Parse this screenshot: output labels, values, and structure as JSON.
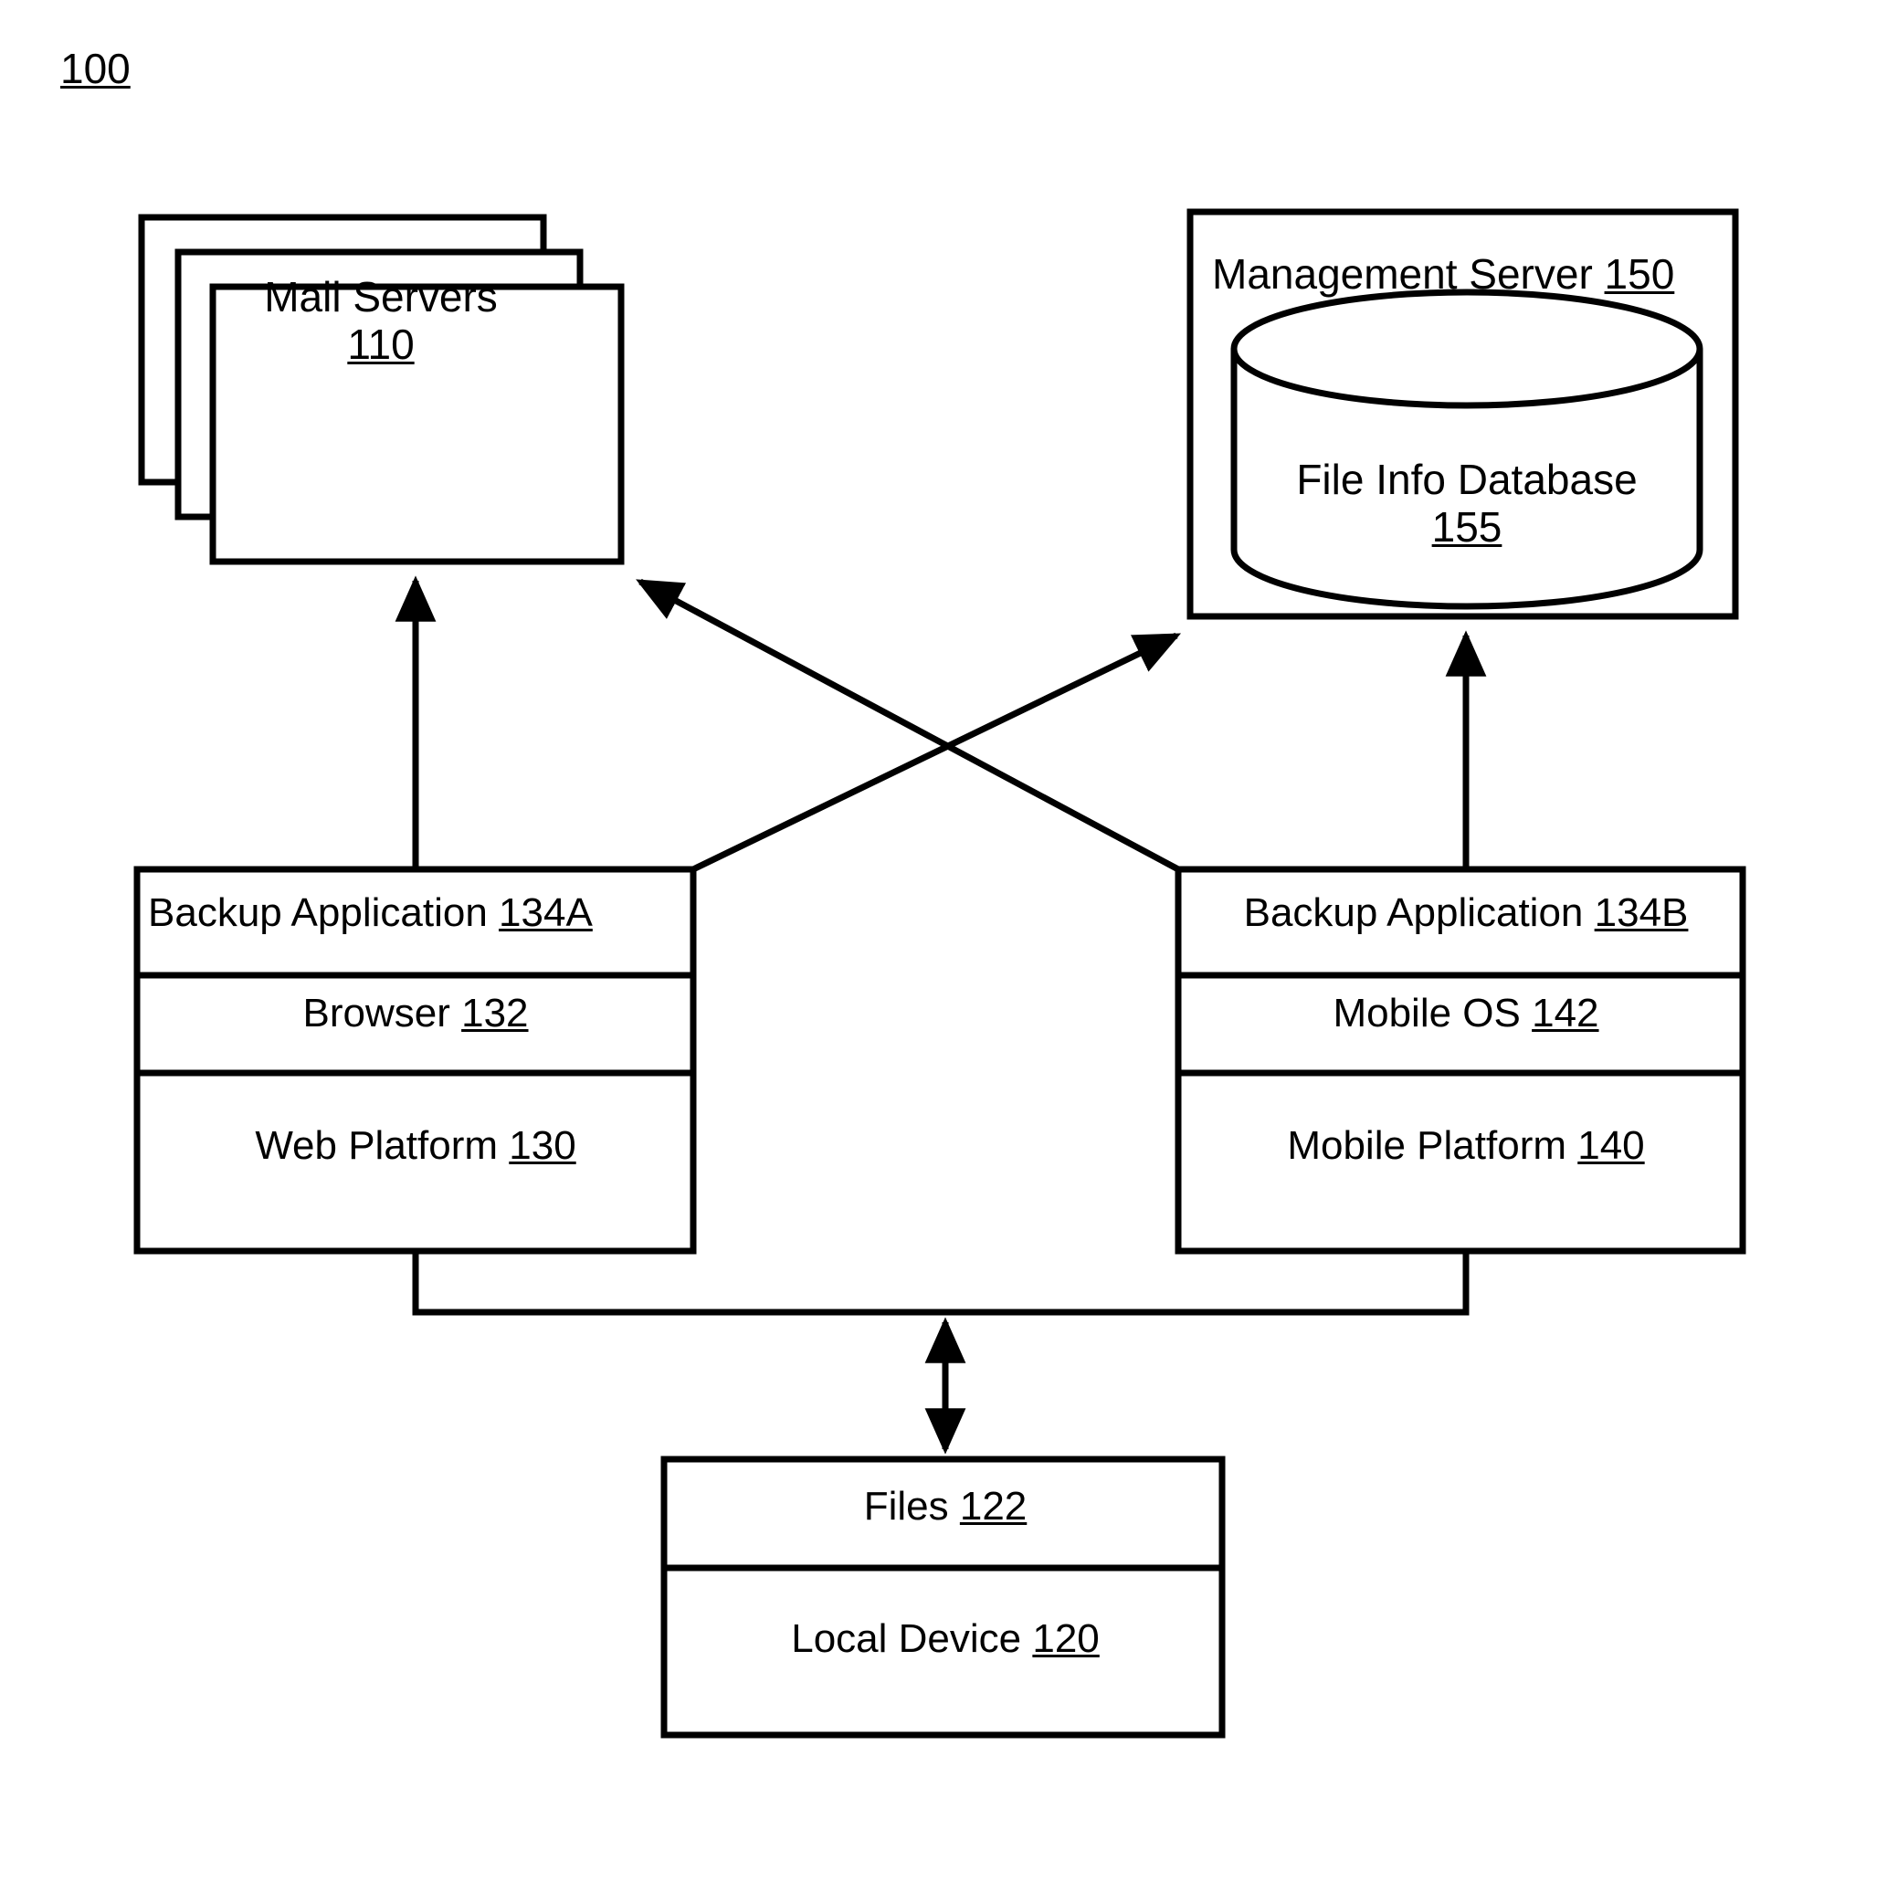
{
  "figure": {
    "number": "100"
  },
  "nodes": {
    "mail_servers": {
      "title": "Mail Servers",
      "ref": "110",
      "stack_count": 3
    },
    "management_server": {
      "title": "Management Server",
      "ref": "150",
      "database": {
        "title": "File Info Database",
        "ref": "155",
        "shape": "cylinder"
      }
    },
    "web_platform_stack": {
      "layers": [
        {
          "title": "Backup Application",
          "ref": "134A"
        },
        {
          "title": "Browser",
          "ref": "132"
        },
        {
          "title": "Web Platform",
          "ref": "130"
        }
      ]
    },
    "mobile_platform_stack": {
      "layers": [
        {
          "title": "Backup Application",
          "ref": "134B"
        },
        {
          "title": "Mobile OS",
          "ref": "142"
        },
        {
          "title": "Mobile Platform",
          "ref": "140"
        }
      ]
    },
    "local_device": {
      "layers": [
        {
          "title": "Files",
          "ref": "122"
        },
        {
          "title": "Local Device",
          "ref": "120"
        }
      ]
    }
  },
  "connections": [
    {
      "id": "web-to-mail",
      "from": "Web Platform 130",
      "to": "Mail Servers 110",
      "arrow": "single"
    },
    {
      "id": "mobile-to-mail",
      "from": "Mobile Platform 140",
      "to": "Mail Servers 110",
      "arrow": "single"
    },
    {
      "id": "web-to-mgmt",
      "from": "Web Platform 130",
      "to": "Management Server 150",
      "arrow": "single"
    },
    {
      "id": "mobile-to-mgmt",
      "from": "Mobile Platform 140",
      "to": "Management Server 150",
      "arrow": "single"
    },
    {
      "id": "platforms-to-local-device",
      "from": "Platforms bus",
      "to": "Files 122",
      "arrow": "double"
    }
  ],
  "style": {
    "stroke": "#000000",
    "background": "#ffffff"
  }
}
